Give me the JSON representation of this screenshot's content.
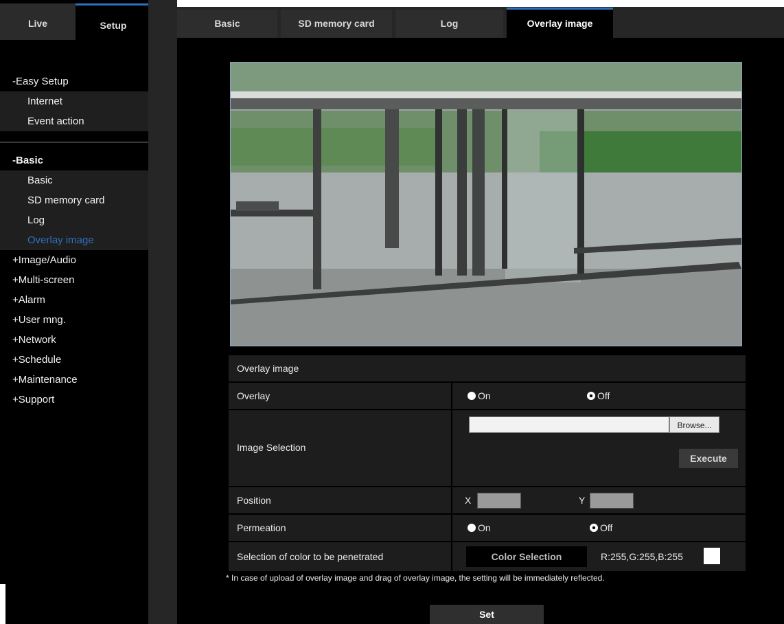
{
  "sidebar": {
    "top_tabs": {
      "live": "Live",
      "setup": "Setup"
    },
    "easy_setup": {
      "header": "-Easy Setup",
      "items": [
        "Internet",
        "Event action"
      ]
    },
    "basic": {
      "header": "-Basic",
      "items": [
        "Basic",
        "SD memory card",
        "Log",
        "Overlay image"
      ],
      "active": "Overlay image"
    },
    "groups": [
      "+Image/Audio",
      "+Multi-screen",
      "+Alarm",
      "+User mng.",
      "+Network",
      "+Schedule",
      "+Maintenance",
      "+Support"
    ]
  },
  "tabs": [
    {
      "label": "Basic",
      "active": false
    },
    {
      "label": "SD memory card",
      "active": false
    },
    {
      "label": "Log",
      "active": false
    },
    {
      "label": "Overlay image",
      "active": true
    }
  ],
  "panel": {
    "title": "Overlay image",
    "overlay": {
      "label": "Overlay",
      "on": "On",
      "off": "Off",
      "selected": "Off"
    },
    "image_selection": {
      "label": "Image Selection",
      "file_value": "",
      "browse": "Browse...",
      "execute": "Execute"
    },
    "position": {
      "label": "Position",
      "x_label": "X",
      "y_label": "Y",
      "x_value": "",
      "y_value": ""
    },
    "permeation": {
      "label": "Permeation",
      "on": "On",
      "off": "Off",
      "selected": "Off"
    },
    "color": {
      "label": "Selection of color to be penetrated",
      "button": "Color Selection",
      "value": "R:255,G:255,B:255",
      "swatch": "#ffffff"
    }
  },
  "note": "* In case of upload of overlay image and drag of overlay image, the setting will be immediately reflected.",
  "set_button": "Set",
  "colors": {
    "accent": "#2e70bf",
    "panel": "#1d1d1d",
    "background": "#000000"
  }
}
